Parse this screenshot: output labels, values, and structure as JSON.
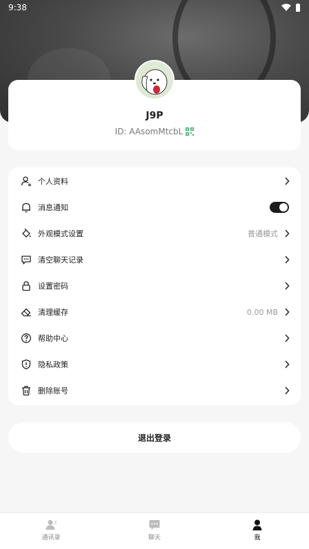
{
  "status_bar": {
    "time": "9:38"
  },
  "profile": {
    "name": "J9P",
    "id_text": "ID: AAsomMtcbL"
  },
  "menu": {
    "items": [
      {
        "label": "个人资料",
        "value": "",
        "icon": "user-icon"
      },
      {
        "label": "消息通知",
        "value": "",
        "icon": "bell-icon",
        "toggle_on": true
      },
      {
        "label": "外观模式设置",
        "value": "普通模式",
        "icon": "paint-bucket-icon"
      },
      {
        "label": "清空聊天记录",
        "value": "",
        "icon": "chat-bubble-icon"
      },
      {
        "label": "设置密码",
        "value": "",
        "icon": "lock-icon"
      },
      {
        "label": "清理缓存",
        "value": "0.00 MB",
        "icon": "eraser-icon"
      },
      {
        "label": "帮助中心",
        "value": "",
        "icon": "help-circle-icon"
      },
      {
        "label": "隐私政策",
        "value": "",
        "icon": "shield-icon"
      },
      {
        "label": "删除账号",
        "value": "",
        "icon": "trash-icon"
      }
    ]
  },
  "logout_label": "退出登录",
  "tabbar": {
    "tabs": [
      {
        "label": "通讯录",
        "active": false
      },
      {
        "label": "聊天",
        "active": false
      },
      {
        "label": "我",
        "active": true
      }
    ]
  },
  "colors": {
    "accent": "#1c1c1c",
    "qr_green": "#3cb371"
  }
}
